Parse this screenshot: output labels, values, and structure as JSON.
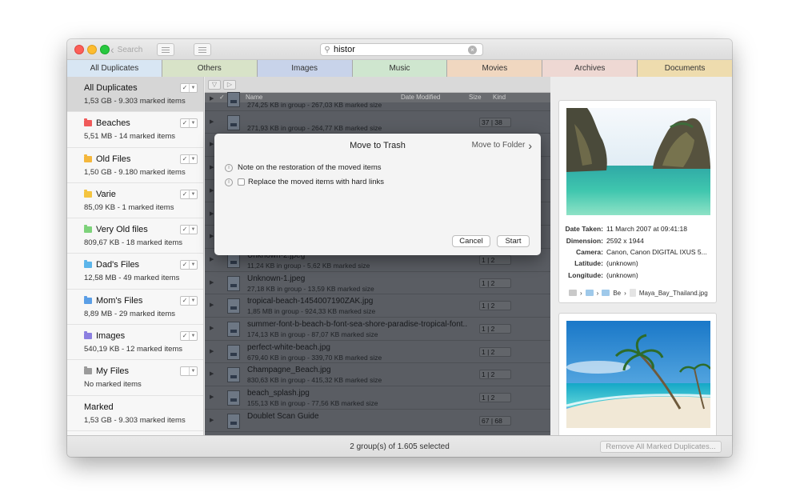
{
  "titlebar": {
    "back_label": "Search",
    "search_value": "histor"
  },
  "tabs": [
    {
      "label": "All Duplicates",
      "color": "#d8e6f3"
    },
    {
      "label": "Others",
      "color": "#d8e3c8"
    },
    {
      "label": "Images",
      "color": "#c8d3ea"
    },
    {
      "label": "Music",
      "color": "#cfe6cf"
    },
    {
      "label": "Movies",
      "color": "#f0d7c0"
    },
    {
      "label": "Archives",
      "color": "#eed8d3"
    },
    {
      "label": "Documents",
      "color": "#eedcae"
    }
  ],
  "sidebar": {
    "items": [
      {
        "name": "All Duplicates",
        "sub": "1,53 GB - 9.303 marked items",
        "checked": "✓",
        "folder": ""
      },
      {
        "name": "Beaches",
        "sub": "5,51 MB - 14 marked items",
        "checked": "✓",
        "folder": "#f05a5a"
      },
      {
        "name": "Old Files",
        "sub": "1,50 GB - 9.180 marked items",
        "checked": "✓",
        "folder": "#f4b73c"
      },
      {
        "name": "Varie",
        "sub": "85,09 KB - 1 marked items",
        "checked": "✓",
        "folder": "#f4c440"
      },
      {
        "name": "Very Old files",
        "sub": "809,67 KB - 18 marked items",
        "checked": "✓",
        "folder": "#7dd27a"
      },
      {
        "name": "Dad's Files",
        "sub": "12,58 MB - 49 marked items",
        "checked": "✓",
        "folder": "#5cb5ea"
      },
      {
        "name": "Mom's Files",
        "sub": "8,89 MB - 29 marked items",
        "checked": "✓",
        "folder": "#5a9ee6"
      },
      {
        "name": "Images",
        "sub": "540,19 KB - 12 marked items",
        "checked": "✓",
        "folder": "#8b7fe0"
      },
      {
        "name": "My Files",
        "sub": "No marked items",
        "checked": "",
        "folder": "#9a9a9a"
      },
      {
        "name": "Marked",
        "sub": "1,53 GB - 9.303 marked items",
        "checked": "",
        "folder": ""
      }
    ]
  },
  "columns": {
    "name": "Name",
    "date": "Date Modified",
    "size": "Size",
    "kind": "Kind"
  },
  "rows": [
    {
      "name": "",
      "sub": "274,25 KB in group - 267,03 KB marked size",
      "count": "",
      "top": 0
    },
    {
      "name": "",
      "sub": "271,93 KB in group - 264,77 KB marked size",
      "count": "37 | 38"
    },
    {
      "name": "",
      "sub": "",
      "count": ""
    },
    {
      "name": "",
      "sub": "",
      "count": ""
    },
    {
      "name": "",
      "sub": "",
      "count": ""
    },
    {
      "name": "",
      "sub": "",
      "count": ""
    },
    {
      "name": "",
      "sub": "",
      "count": ""
    },
    {
      "name": "Unknown-2.jpeg",
      "sub": "11,24 KB in group - 5,62 KB marked size",
      "count": "1 | 2"
    },
    {
      "name": "Unknown-1.jpeg",
      "sub": "27,18 KB in group - 13,59 KB marked size",
      "count": "1 | 2"
    },
    {
      "name": "tropical-beach-1454007190ZAK.jpg",
      "sub": "1,85 MB in group - 924,33 KB marked size",
      "count": "1 | 2"
    },
    {
      "name": "summer-font-b-beach-b-font-sea-shore-paradise-tropical-font...",
      "sub": "174,13 KB in group - 87,07 KB marked size",
      "count": "1 | 2"
    },
    {
      "name": "perfect-white-beach.jpg",
      "sub": "679,40 KB in group - 339,70 KB marked size",
      "count": "1 | 2"
    },
    {
      "name": "Champagne_Beach.jpg",
      "sub": "830,63 KB in group - 415,32 KB marked size",
      "count": "1 | 2"
    },
    {
      "name": "beach_splash.jpg",
      "sub": "155,13 KB in group - 77,56 KB marked size",
      "count": "1 | 2"
    },
    {
      "name": "Doublet Scan Guide",
      "sub": "",
      "count": "67 | 68"
    }
  ],
  "modal": {
    "title": "Move to Trash",
    "move_to_folder": "Move to Folder",
    "note": "Note on the restoration of the moved items",
    "replace": "Replace the moved items with hard links",
    "cancel": "Cancel",
    "start": "Start"
  },
  "details": {
    "date_taken_label": "Date Taken:",
    "date_taken": "11 March 2007 at 09:41:18",
    "dimension_label": "Dimension:",
    "dimension": "2592 x 1944",
    "camera_label": "Camera:",
    "camera": "Canon, Canon DIGITAL IXUS 5...",
    "latitude_label": "Latitude:",
    "latitude": "(unknown)",
    "longitude_label": "Longitude:",
    "longitude": "(unknown)",
    "path_mid": "Be",
    "path_file": "Maya_Bay_Thailand.jpg"
  },
  "status": {
    "text": "2 group(s) of 1.605 selected",
    "remove_button": "Remove All Marked Duplicates..."
  }
}
